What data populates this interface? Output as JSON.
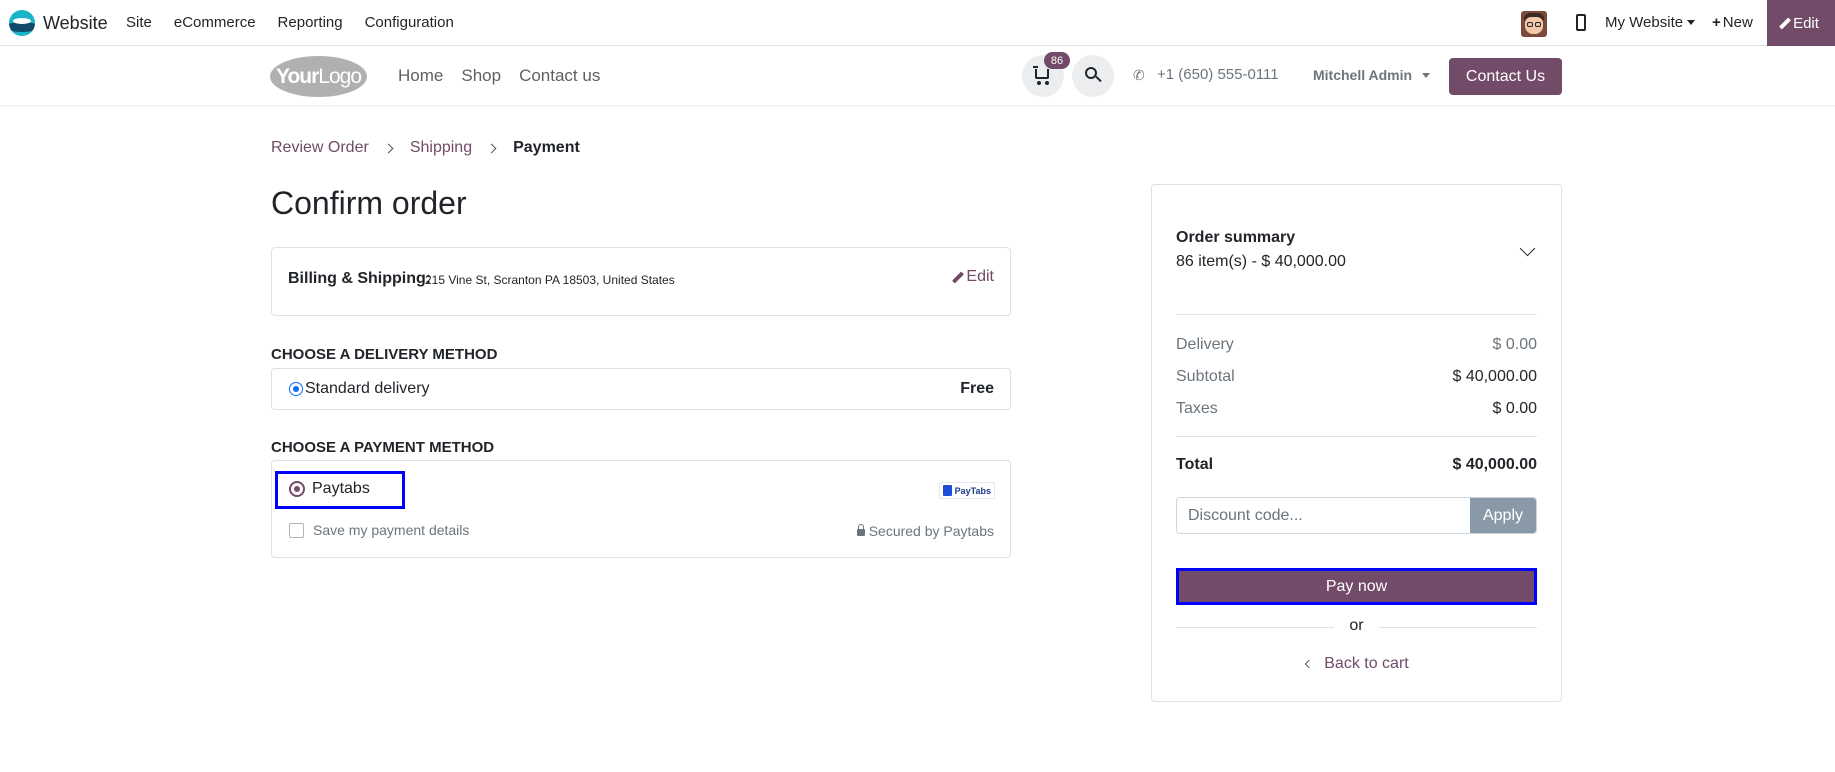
{
  "admin_bar": {
    "app_name": "Website",
    "menu": [
      "Site",
      "eCommerce",
      "Reporting",
      "Configuration"
    ],
    "website_selector": "My Website",
    "new_label": "New",
    "edit_label": "Edit"
  },
  "site_header": {
    "logo_text_bold": "Your",
    "logo_text_light": "Logo",
    "nav": [
      "Home",
      "Shop",
      "Contact us"
    ],
    "cart_count": "86",
    "phone": "+1 (650) 555-0111",
    "user": "Mitchell Admin",
    "contact_button": "Contact Us"
  },
  "breadcrumb": {
    "items": [
      "Review Order",
      "Shipping"
    ],
    "active": "Payment"
  },
  "page_title": "Confirm order",
  "billing": {
    "label": "Billing & Shipping:",
    "address": "215 Vine St, Scranton PA 18503, United States",
    "edit_label": "Edit"
  },
  "delivery": {
    "heading": "CHOOSE A DELIVERY METHOD",
    "method_name": "Standard delivery",
    "method_price": "Free"
  },
  "payment": {
    "heading": "CHOOSE A PAYMENT METHOD",
    "provider": "Paytabs",
    "provider_logo": "PayTabs",
    "save_details": "Save my payment details",
    "secured_by": "Secured by Paytabs"
  },
  "summary": {
    "title": "Order summary",
    "count_line": "86 item(s) -  $ 40,000.00",
    "rows": [
      {
        "label": "Delivery",
        "value": "$ 0.00"
      },
      {
        "label": "Subtotal",
        "value": "$ 40,000.00"
      },
      {
        "label": "Taxes",
        "value": "$ 0.00"
      }
    ],
    "total_label": "Total",
    "total_value": "$ 40,000.00",
    "discount_placeholder": "Discount code...",
    "apply_label": "Apply",
    "pay_label": "Pay now",
    "or_label": "or",
    "back_label": "Back to cart"
  },
  "colors": {
    "brand": "#714b67",
    "highlight": "#0000ff",
    "radio_selected": "#0d6efd"
  }
}
